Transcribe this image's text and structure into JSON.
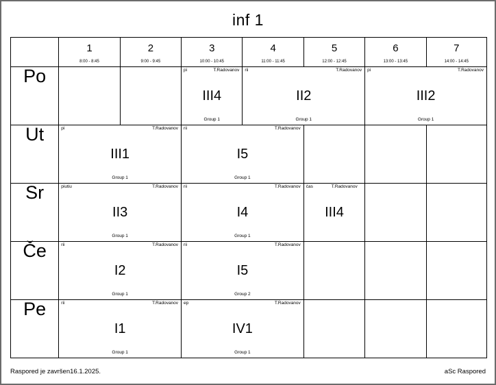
{
  "title": "inf 1",
  "periods": [
    {
      "num": "1",
      "time": "8:00 - 8:45"
    },
    {
      "num": "2",
      "time": "9:00 - 9:45"
    },
    {
      "num": "3",
      "time": "10:00 - 10:45"
    },
    {
      "num": "4",
      "time": "11:00 - 11:45"
    },
    {
      "num": "5",
      "time": "12:00 - 12:45"
    },
    {
      "num": "6",
      "time": "13:00 - 13:45"
    },
    {
      "num": "7",
      "time": "14:00 - 14:45"
    }
  ],
  "days": [
    {
      "label": "Po"
    },
    {
      "label": "Ut"
    },
    {
      "label": "Sr"
    },
    {
      "label": "Če"
    },
    {
      "label": "Pe"
    }
  ],
  "lessons": {
    "mon": [
      {
        "subject": "pi",
        "teacher": "T.Radovanov",
        "class": "III4",
        "group": "Group 1"
      },
      {
        "subject": "rii",
        "teacher": "T.Radovanov",
        "class": "II2",
        "group": "Group 1"
      },
      {
        "subject": "pi",
        "teacher": "T.Radovanov",
        "class": "III2",
        "group": "Group 1"
      }
    ],
    "tue": [
      {
        "subject": "pi",
        "teacher": "T.Radovanov",
        "class": "III1",
        "group": "Group 1"
      },
      {
        "subject": "rii",
        "teacher": "T.Radovanov",
        "class": "I5",
        "group": "Group 1"
      }
    ],
    "wed": [
      {
        "subject": "piutiu",
        "teacher": "T.Radovanov",
        "class": "II3",
        "group": "Group 1"
      },
      {
        "subject": "rii",
        "teacher": "T.Radovanov",
        "class": "I4",
        "group": "Group 1"
      },
      {
        "subject": "čas",
        "teacher": "T.Radovanov",
        "class": "III4",
        "group": ""
      }
    ],
    "thu": [
      {
        "subject": "rii",
        "teacher": "T.Radovanov",
        "class": "I2",
        "group": "Group 1"
      },
      {
        "subject": "rii",
        "teacher": "T.Radovanov",
        "class": "I5",
        "group": "Group 2"
      }
    ],
    "fri": [
      {
        "subject": "rii",
        "teacher": "T.Radovanov",
        "class": "I1",
        "group": "Group 1"
      },
      {
        "subject": "ep",
        "teacher": "T.Radovanov",
        "class": "IV1",
        "group": "Group 1"
      }
    ]
  },
  "footer": {
    "left": "Raspored je završen16.1.2025.",
    "right": "aSc Raspored"
  }
}
